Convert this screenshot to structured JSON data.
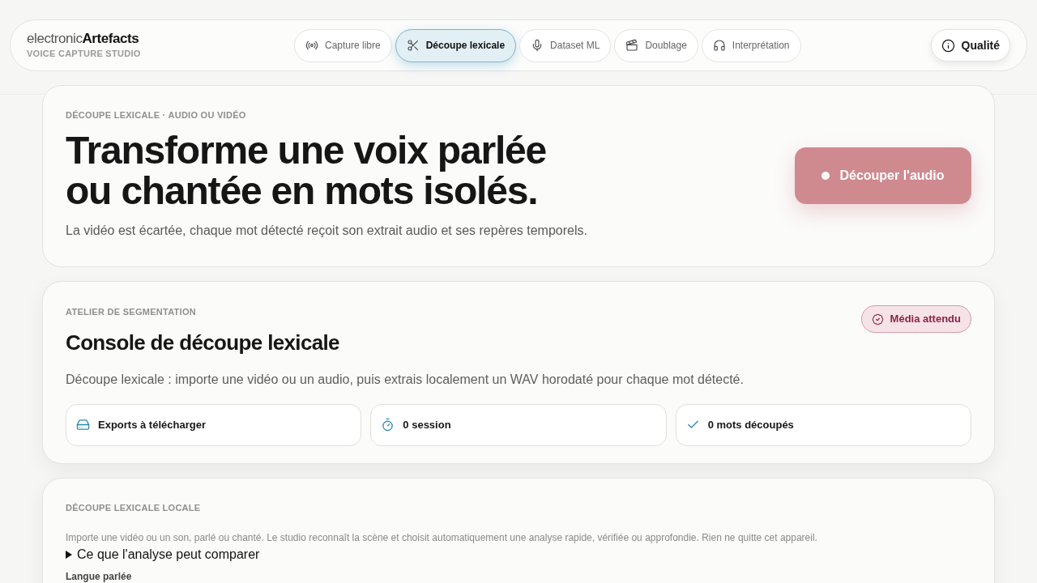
{
  "brand": {
    "light": "electronic",
    "bold": "Artefacts",
    "subtitle": "VOICE CAPTURE STUDIO"
  },
  "nav": [
    {
      "label": "Capture libre",
      "selected": false
    },
    {
      "label": "Découpe lexicale",
      "selected": true
    },
    {
      "label": "Dataset ML",
      "selected": false
    },
    {
      "label": "Doublage",
      "selected": false
    },
    {
      "label": "Interprétation",
      "selected": false
    }
  ],
  "quality_button": "Qualité",
  "hero": {
    "eyebrow": "DÉCOUPE LEXICALE · AUDIO OU VIDÉO",
    "title_lines": [
      "Transforme une voix parlée",
      "ou chantée en mots isolés."
    ],
    "subtitle": "La vidéo est écartée, chaque mot détecté reçoit son extrait audio et ses repères temporels.",
    "action": {
      "label": "Découper l'audio",
      "disabled": true
    }
  },
  "console": {
    "eyebrow": "ATELIER DE SEGMENTATION",
    "title": "Console de découpe lexicale",
    "status": "Média attendu",
    "description": "Découpe lexicale : importe une vidéo ou un audio, puis extrais localement un WAV horodaté pour chaque mot détecté.",
    "stats": [
      {
        "label": "Exports à télécharger"
      },
      {
        "label": "0 session"
      },
      {
        "label": "0 mots découpés"
      }
    ]
  },
  "local": {
    "eyebrow": "DÉCOUPE LEXICALE LOCALE",
    "description": "Importe une vidéo ou un son, parlé ou chanté. Le studio reconnaît la scène et choisit automatiquement une analyse rapide, vérifiée ou approfondie. Rien ne quitte cet appareil.",
    "details": {
      "summary": "Ce que l'analyse peut comparer",
      "expanded": false
    },
    "field_label": "Langue parlée"
  }
}
